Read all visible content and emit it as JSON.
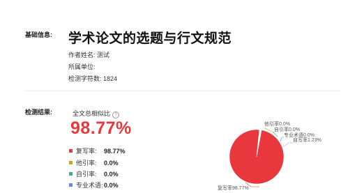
{
  "basic": {
    "label": "基础信息:",
    "title": "学术论文的选题与行文规范",
    "author": "作者姓名: 测试",
    "unit": "所属单位:",
    "char_count": "检测字符数: 1824"
  },
  "result": {
    "label": "检测结果:",
    "similarity_label": "全文总相似比",
    "help_icon": "?",
    "similarity_value": "98.77%",
    "legend": [
      {
        "label": "复写率:",
        "value": "98.77%",
        "color": "#e8383d"
      },
      {
        "label": "他引率:",
        "value": "0.0%",
        "color": "#d6a400"
      },
      {
        "label": "自引率:",
        "value": "0.0%",
        "color": "#3cb371"
      },
      {
        "label": "专业术语:",
        "value": "0.0%",
        "color": "#5b8ef0"
      }
    ]
  },
  "chart_data": {
    "type": "pie",
    "slices": [
      {
        "label": "复写率98.77%",
        "value": 98.77,
        "color": "#e8383d"
      },
      {
        "label": "自写率1.23%",
        "value": 1.23,
        "color": "#ffffff"
      },
      {
        "label": "他引率0.0%",
        "value": 0.0,
        "color": "#d6a400"
      },
      {
        "label": "自引率0.0%",
        "value": 0.0,
        "color": "#3cb371"
      },
      {
        "label": "专业术语0.0%",
        "value": 0.0,
        "color": "#5b8ef0"
      }
    ]
  }
}
